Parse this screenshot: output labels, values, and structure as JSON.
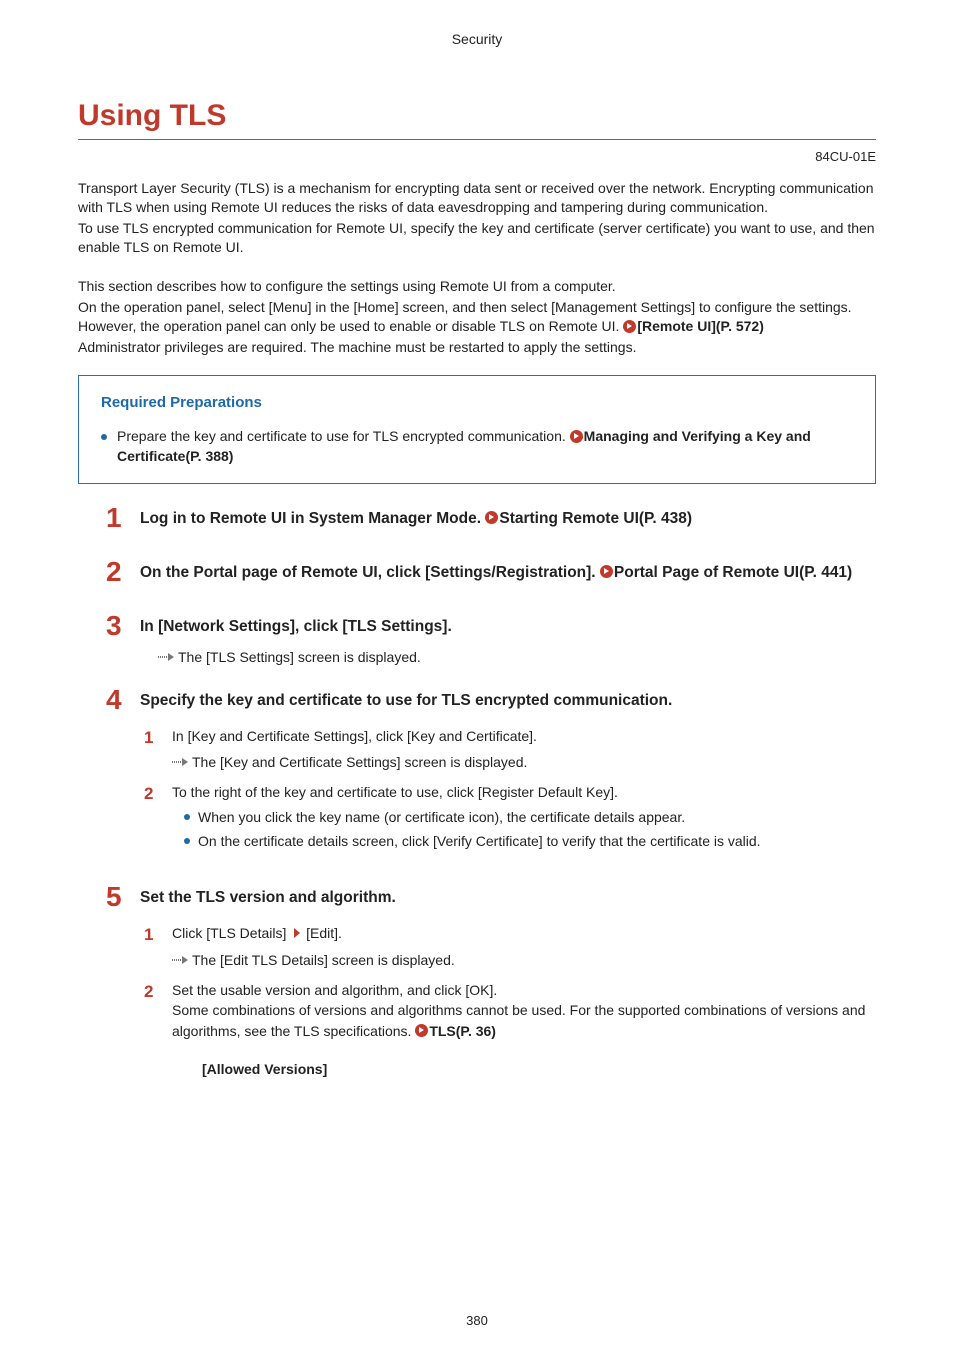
{
  "header": {
    "section": "Security"
  },
  "title": "Using TLS",
  "doc_code": "84CU-01E",
  "intro": {
    "p1": "Transport Layer Security (TLS) is a mechanism for encrypting data sent or received over the network. Encrypting communication with TLS when using Remote UI reduces the risks of data eavesdropping and tampering during communication.",
    "p2": "To use TLS encrypted communication for Remote UI, specify the key and certificate (server certificate) you want to use, and then enable TLS on Remote UI.",
    "p3a": "This section describes how to configure the settings using Remote UI from a computer.",
    "p3b_pre": "On the operation panel, select [Menu] in the [Home] screen, and then select [Management Settings] to configure the settings. However, the operation panel can only be used to enable or disable TLS on Remote UI. ",
    "p3b_link": "[Remote UI](P. 572)",
    "p4": "Administrator privileges are required. The machine must be restarted to apply the settings."
  },
  "prep": {
    "title": "Required Preparations",
    "item_text": "Prepare the key and certificate to use for TLS encrypted communication. ",
    "item_link": "Managing and Verifying a Key and Certificate(P. 388)"
  },
  "steps": [
    {
      "num": "1",
      "heading_pre": "Log in to Remote UI in System Manager Mode. ",
      "heading_link": "Starting Remote UI(P. 438)"
    },
    {
      "num": "2",
      "heading_pre": "On the Portal page of Remote UI, click [Settings/Registration]. ",
      "heading_link": "Portal Page of Remote UI(P. 441)"
    },
    {
      "num": "3",
      "heading_pre": "In [Network Settings], click [TLS Settings].",
      "result": "The [TLS Settings] screen is displayed."
    },
    {
      "num": "4",
      "heading_pre": "Specify the key and certificate to use for TLS encrypted communication.",
      "subs": [
        {
          "num": "1",
          "text": "In [Key and Certificate Settings], click [Key and Certificate].",
          "result": "The [Key and Certificate Settings] screen is displayed."
        },
        {
          "num": "2",
          "text": "To the right of the key and certificate to use, click [Register Default Key].",
          "bullets": [
            "When you click the key name (or certificate icon), the certificate details appear.",
            "On the certificate details screen, click [Verify Certificate] to verify that the certificate is valid."
          ]
        }
      ]
    },
    {
      "num": "5",
      "heading_pre": "Set the TLS version and algorithm.",
      "subs": [
        {
          "num": "1",
          "click_label_a": "Click [TLS Details]",
          "click_label_b": "[Edit].",
          "result": "The [Edit TLS Details] screen is displayed."
        },
        {
          "num": "2",
          "text_pre": "Set the usable version and algorithm, and click [OK].",
          "text_cont": "Some combinations of versions and algorithms cannot be used. For the supported combinations of versions and algorithms, see the TLS specifications. ",
          "text_link": "TLS(P. 36)",
          "sub_label": "[Allowed Versions]"
        }
      ]
    }
  ],
  "page_number": "380"
}
